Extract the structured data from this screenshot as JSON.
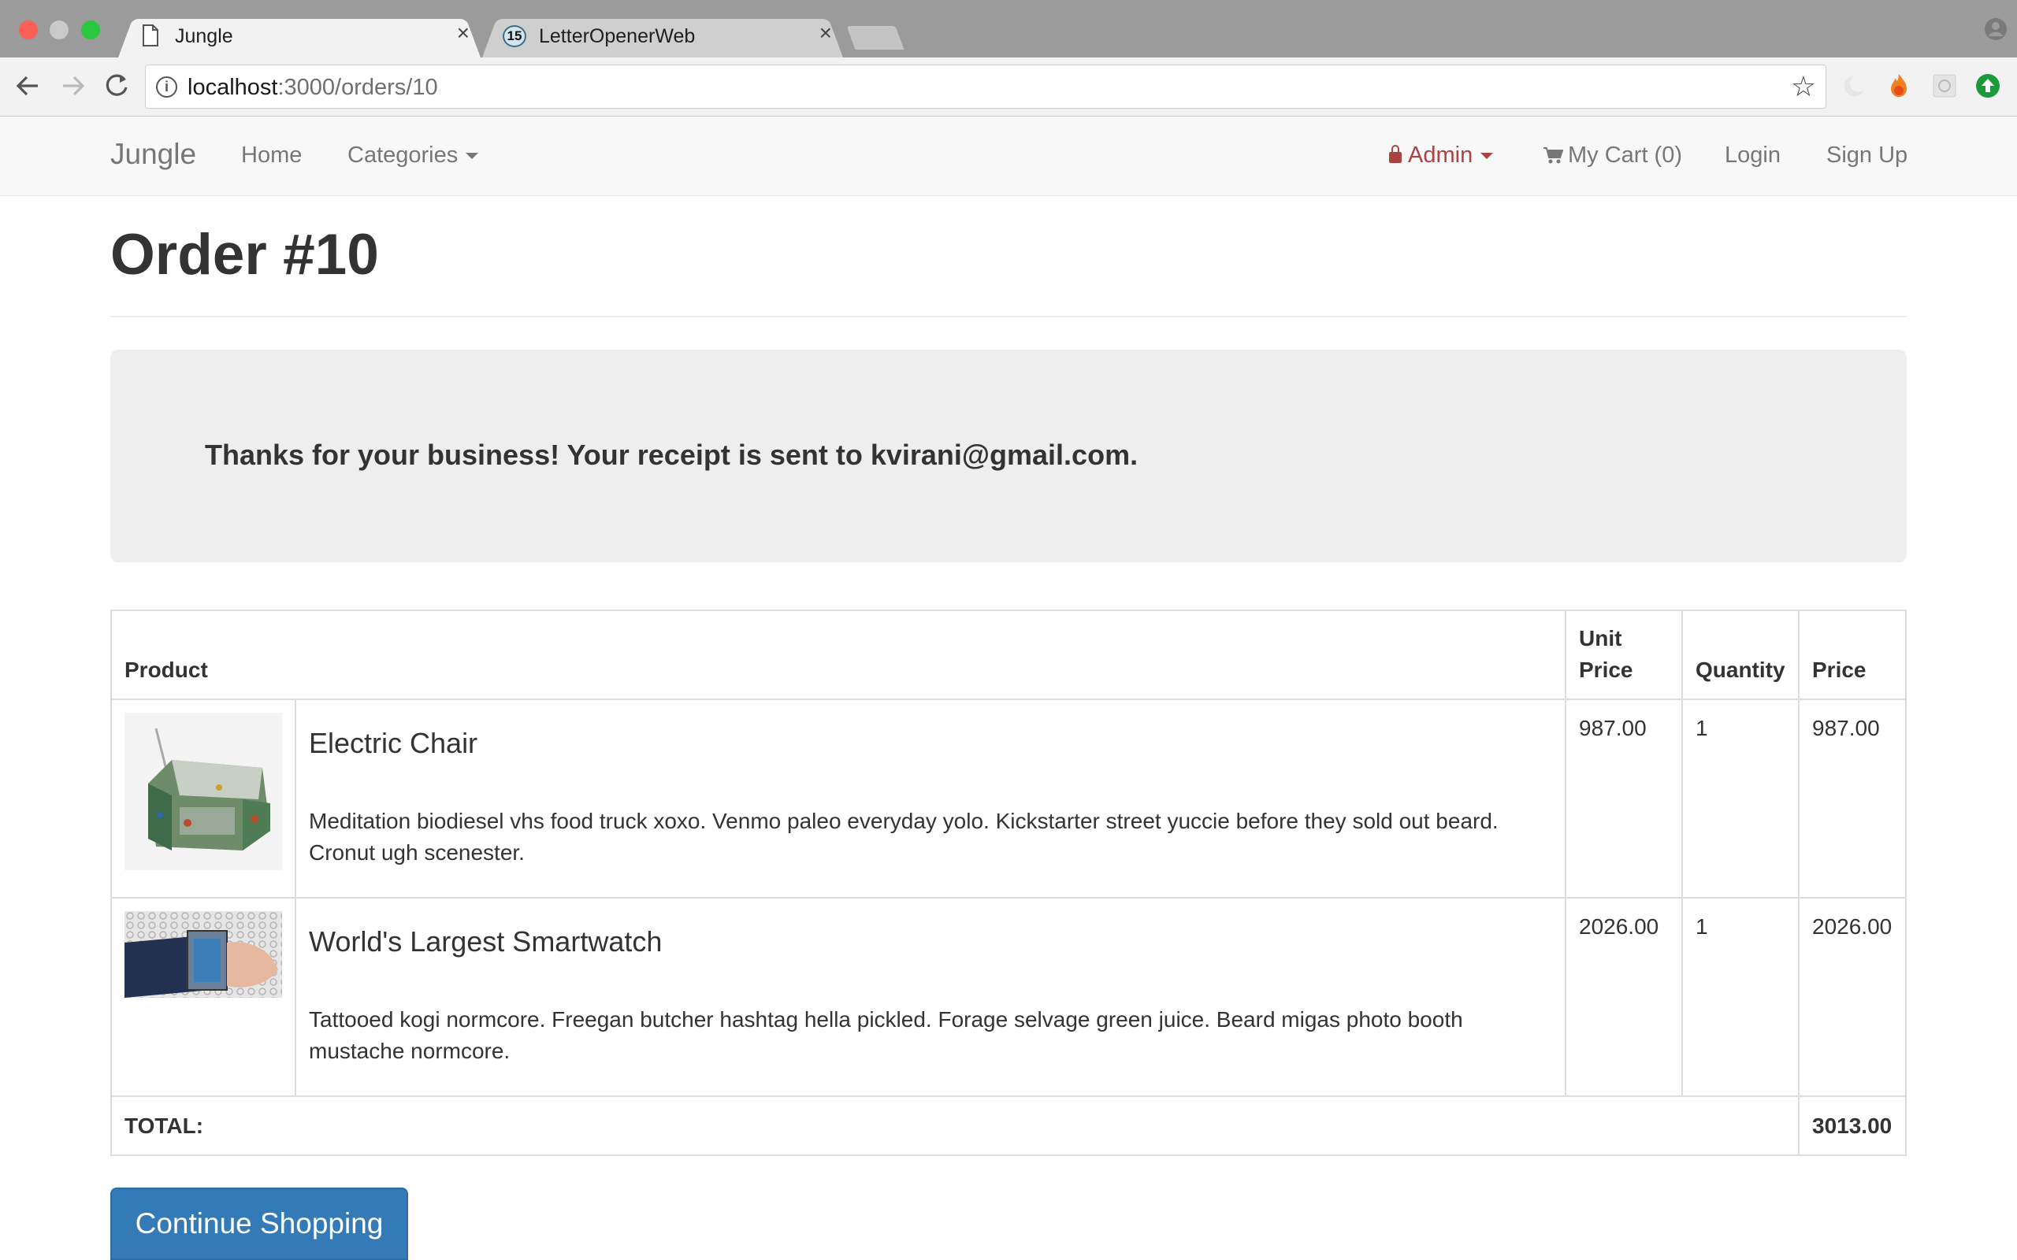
{
  "browser": {
    "tabs": [
      {
        "title": "Jungle",
        "active": true
      },
      {
        "title": "LetterOpenerWeb",
        "active": false,
        "badge": "15"
      }
    ],
    "url_host": "localhost",
    "url_path": ":3000/orders/10"
  },
  "navbar": {
    "brand": "Jungle",
    "home": "Home",
    "categories": "Categories",
    "admin": "Admin",
    "cart": "My Cart (0)",
    "login": "Login",
    "signup": "Sign Up",
    "admin_color": "#a94442"
  },
  "page": {
    "title": "Order #10",
    "thanks_message": "Thanks for your business! Your receipt is sent to kvirani@gmail.com."
  },
  "table": {
    "headers": {
      "product": "Product",
      "unit_price_line1": "Unit",
      "unit_price_line2": "Price",
      "quantity": "Quantity",
      "price": "Price"
    },
    "rows": [
      {
        "name": "Electric Chair",
        "description": "Meditation biodiesel vhs food truck xoxo. Venmo paleo everyday yolo. Kickstarter street yuccie before they sold out beard. Cronut ugh scenester.",
        "unit_price": "987.00",
        "quantity": "1",
        "price": "987.00",
        "image": "electric-chair-photo"
      },
      {
        "name": "World's Largest Smartwatch",
        "description": "Tattooed kogi normcore. Freegan butcher hashtag hella pickled. Forage selvage green juice. Beard migas photo booth mustache normcore.",
        "unit_price": "2026.00",
        "quantity": "1",
        "price": "2026.00",
        "image": "smartwatch-photo"
      }
    ],
    "total_label": "TOTAL:",
    "total_value": "3013.00"
  },
  "actions": {
    "continue_shopping": "Continue Shopping",
    "button_color": "#337ab7"
  }
}
